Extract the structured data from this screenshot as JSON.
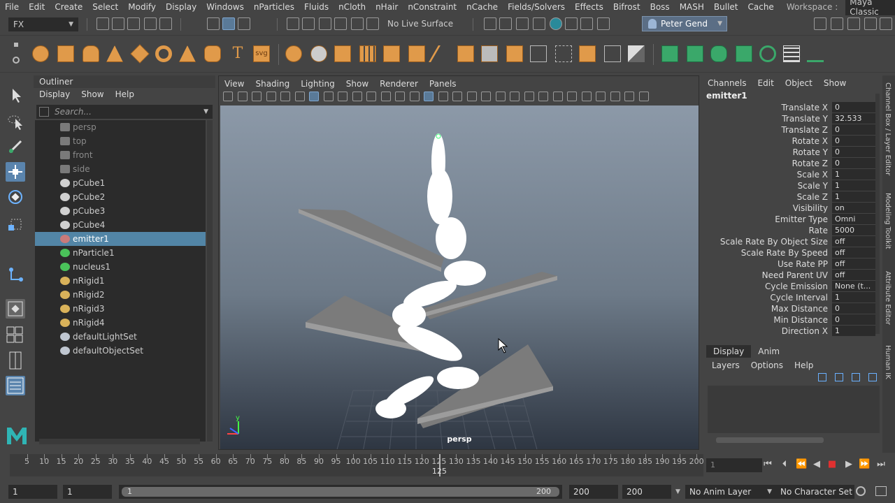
{
  "menubar": {
    "items": [
      "File",
      "Edit",
      "Create",
      "Select",
      "Modify",
      "Display",
      "Windows",
      "nParticles",
      "Fluids",
      "nCloth",
      "nHair",
      "nConstraint",
      "nCache",
      "Fields/Solvers",
      "Effects",
      "Bifrost",
      "Boss",
      "MASH",
      "Bullet",
      "Cache"
    ],
    "workspace_label": "Workspace :",
    "workspace_value": "Maya Classic"
  },
  "statusline": {
    "menuset": "FX",
    "live_surface": "No Live Surface",
    "user": "Peter Gend"
  },
  "shelf": {
    "text_icon": "T",
    "svg_icon": "svg"
  },
  "outliner": {
    "title": "Outliner",
    "menu": [
      "Display",
      "Show",
      "Help"
    ],
    "search_placeholder": "Search...",
    "items": [
      {
        "label": "persp",
        "icon": "camera-icon",
        "dim": true
      },
      {
        "label": "top",
        "icon": "camera-icon",
        "dim": true
      },
      {
        "label": "front",
        "icon": "camera-icon",
        "dim": true
      },
      {
        "label": "side",
        "icon": "camera-icon",
        "dim": true
      },
      {
        "label": "pCube1",
        "icon": "mesh-icon",
        "dim": false
      },
      {
        "label": "pCube2",
        "icon": "mesh-icon",
        "dim": false
      },
      {
        "label": "pCube3",
        "icon": "mesh-icon",
        "dim": false
      },
      {
        "label": "pCube4",
        "icon": "mesh-icon",
        "dim": false
      },
      {
        "label": "emitter1",
        "icon": "emitter-icon",
        "dim": false,
        "selected": true
      },
      {
        "label": "nParticle1",
        "icon": "nparticle-icon",
        "dim": false
      },
      {
        "label": "nucleus1",
        "icon": "nucleus-icon",
        "dim": false
      },
      {
        "label": "nRigid1",
        "icon": "nrigid-icon",
        "dim": false
      },
      {
        "label": "nRigid2",
        "icon": "nrigid-icon",
        "dim": false
      },
      {
        "label": "nRigid3",
        "icon": "nrigid-icon",
        "dim": false
      },
      {
        "label": "nRigid4",
        "icon": "nrigid-icon",
        "dim": false
      },
      {
        "label": "defaultLightSet",
        "icon": "set-icon",
        "dim": false
      },
      {
        "label": "defaultObjectSet",
        "icon": "set-icon",
        "dim": false
      }
    ]
  },
  "viewport": {
    "menu": [
      "View",
      "Shading",
      "Lighting",
      "Show",
      "Renderer",
      "Panels"
    ],
    "camera": "persp",
    "axis_y": "y"
  },
  "channelbox": {
    "menu": [
      "Channels",
      "Edit",
      "Object",
      "Show"
    ],
    "object": "emitter1",
    "channels": [
      {
        "name": "Translate X",
        "value": "0"
      },
      {
        "name": "Translate Y",
        "value": "32.533"
      },
      {
        "name": "Translate Z",
        "value": "0"
      },
      {
        "name": "Rotate X",
        "value": "0"
      },
      {
        "name": "Rotate Y",
        "value": "0"
      },
      {
        "name": "Rotate Z",
        "value": "0"
      },
      {
        "name": "Scale X",
        "value": "1"
      },
      {
        "name": "Scale Y",
        "value": "1"
      },
      {
        "name": "Scale Z",
        "value": "1"
      },
      {
        "name": "Visibility",
        "value": "on"
      },
      {
        "name": "Emitter Type",
        "value": "Omni"
      },
      {
        "name": "Rate",
        "value": "5000"
      },
      {
        "name": "Scale Rate By Object Size",
        "value": "off"
      },
      {
        "name": "Scale Rate By Speed",
        "value": "off"
      },
      {
        "name": "Use Rate PP",
        "value": "off"
      },
      {
        "name": "Need Parent UV",
        "value": "off"
      },
      {
        "name": "Cycle Emission",
        "value": "None (t..."
      },
      {
        "name": "Cycle Interval",
        "value": "1"
      },
      {
        "name": "Max Distance",
        "value": "0"
      },
      {
        "name": "Min Distance",
        "value": "0"
      },
      {
        "name": "Direction X",
        "value": "1"
      }
    ]
  },
  "sidetabs": [
    "Channel Box / Layer Editor",
    "Modeling Toolkit",
    "Attribute Editor",
    "Human IK"
  ],
  "layereditor": {
    "tabs": [
      "Display",
      "Anim"
    ],
    "menu": [
      "Layers",
      "Options",
      "Help"
    ]
  },
  "timeslider": {
    "ticks": [
      5,
      10,
      15,
      20,
      25,
      30,
      35,
      40,
      45,
      50,
      55,
      60,
      65,
      70,
      75,
      80,
      85,
      90,
      95,
      100,
      105,
      110,
      115,
      120,
      125,
      130,
      135,
      140,
      145,
      150,
      155,
      160,
      165,
      170,
      175,
      180,
      185,
      190,
      195,
      200
    ],
    "current": "125",
    "frame_field": "1"
  },
  "rangeslider": {
    "start": "1",
    "anim_start": "1",
    "bar_start": "1",
    "bar_end": "200",
    "anim_end": "200",
    "end": "200",
    "anim_layer": "No Anim Layer",
    "char_set": "No Character Set"
  }
}
